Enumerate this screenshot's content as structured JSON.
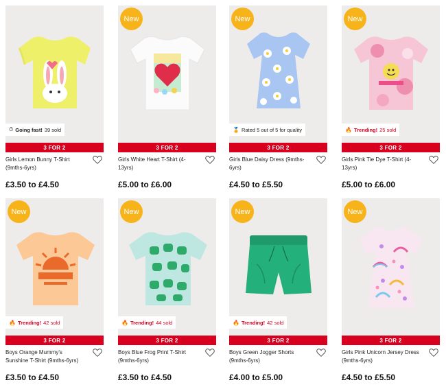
{
  "colors": {
    "promo": "#d8001f",
    "badge": "#f7b31a",
    "tile": "#eeeceb"
  },
  "products": [
    {
      "name": "Girls Lemon Bunny T-Shirt (9mths-6yrs)",
      "price": "£3.50 to £4.50",
      "promo": "3 FOR 2",
      "badge": "",
      "note_icon": "stopwatch-icon",
      "note_strong": "Going fast!",
      "note_text": "39 sold"
    },
    {
      "name": "Girls White Heart T-Shirt (4-13yrs)",
      "price": "£5.00 to £6.00",
      "promo": "3 FOR 2",
      "badge": "New",
      "note_icon": "",
      "note_strong": "",
      "note_text": ""
    },
    {
      "name": "Girls Blue Daisy Dress (9mths-6yrs)",
      "price": "£4.50 to £5.50",
      "promo": "3 FOR 2",
      "badge": "New",
      "note_icon": "medal-icon",
      "note_strong": "",
      "note_text": "Rated 5 out of 5 for quality"
    },
    {
      "name": "Girls Pink Tie Dye T-Shirt (4-13yrs)",
      "price": "£5.00 to £6.00",
      "promo": "3 FOR 2",
      "badge": "New",
      "note_icon": "fire-icon",
      "note_strong": "Trending!",
      "note_text": "25 sold"
    },
    {
      "name": "Boys Orange Mummy's Sunshine T-Shirt (9mths-6yrs)",
      "price": "£3.50 to £4.50",
      "promo": "3 FOR 2",
      "badge": "New",
      "note_icon": "fire-icon",
      "note_strong": "Trending!",
      "note_text": "42 sold"
    },
    {
      "name": "Boys Blue Frog Print T-Shirt (9mths-6yrs)",
      "price": "£3.50 to £4.50",
      "promo": "3 FOR 2",
      "badge": "New",
      "note_icon": "fire-icon",
      "note_strong": "Trending!",
      "note_text": "44 sold"
    },
    {
      "name": "Boys Green Jogger Shorts (9mths-6yrs)",
      "price": "£4.00 to £5.00",
      "promo": "3 FOR 2",
      "badge": "New",
      "note_icon": "fire-icon",
      "note_strong": "Trending!",
      "note_text": "42 sold"
    },
    {
      "name": "Girls Pink Unicorn Jersey Dress (9mths-6yrs)",
      "price": "£4.50 to £5.50",
      "promo": "3 FOR 2",
      "badge": "New",
      "note_icon": "",
      "note_strong": "",
      "note_text": ""
    }
  ]
}
